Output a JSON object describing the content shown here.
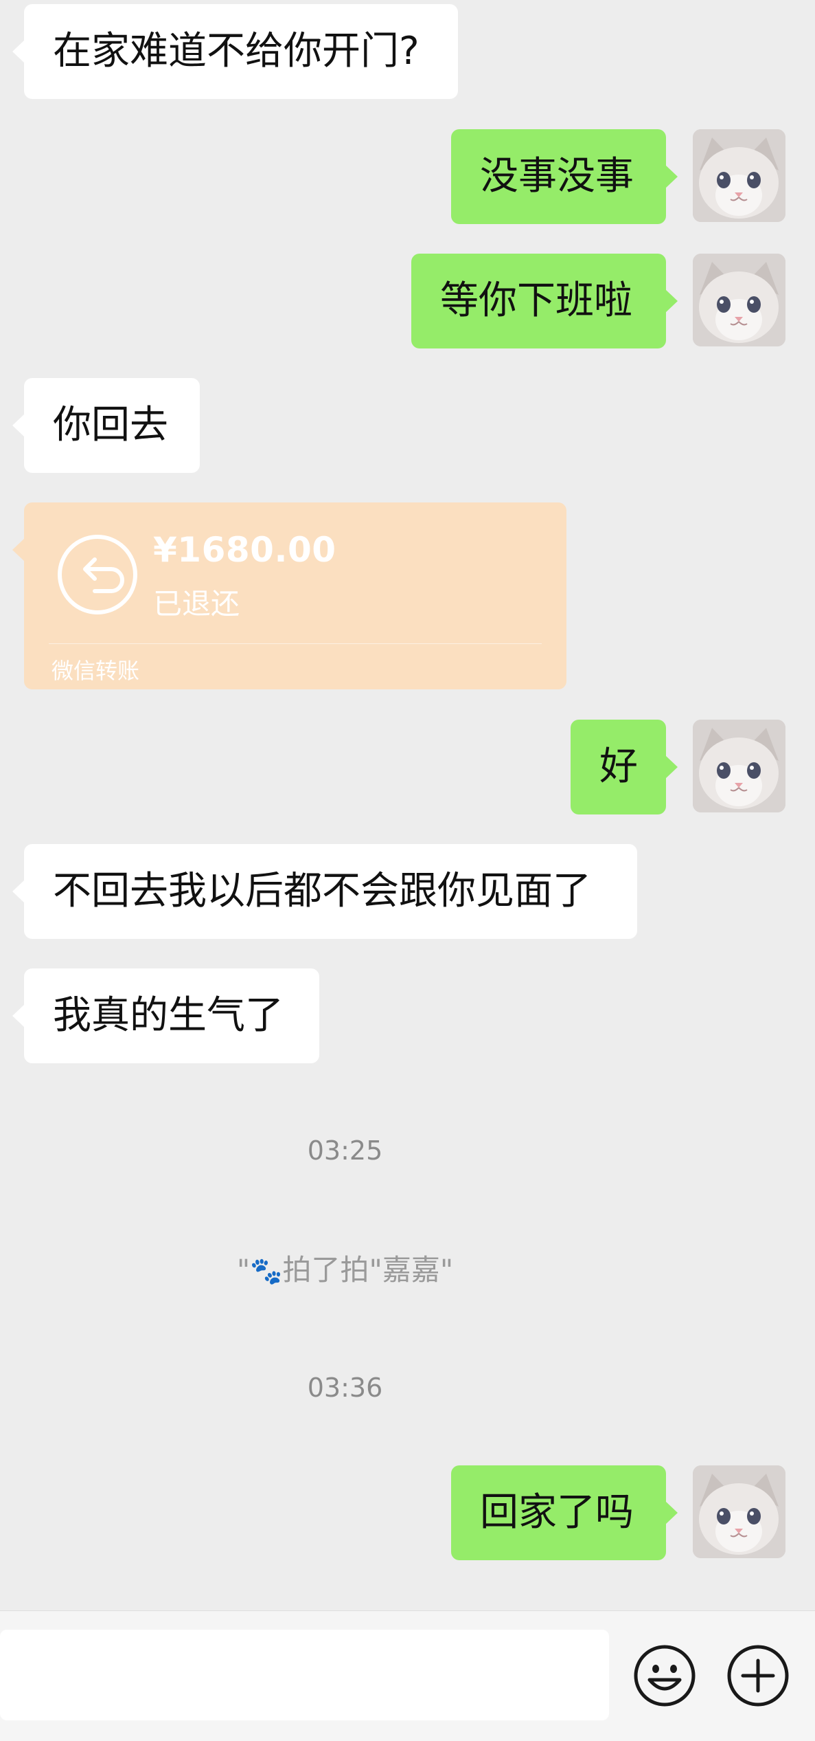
{
  "messages": [
    {
      "from": "other",
      "text": "在家难道不给你开门?"
    },
    {
      "from": "me",
      "text": "没事没事"
    },
    {
      "from": "me",
      "text": "等你下班啦"
    },
    {
      "from": "other",
      "text": "你回去"
    },
    {
      "from": "me",
      "text": "好"
    },
    {
      "from": "other",
      "text": "不回去我以后都不会跟你见面了"
    },
    {
      "from": "other",
      "text": "我真的生气了"
    },
    {
      "from": "me",
      "text": "回家了吗"
    }
  ],
  "transfer": {
    "amount": "¥1680.00",
    "status": "已退还",
    "label": "微信转账",
    "icon": "return-arrow-icon",
    "color": "#fbdfc0"
  },
  "timestamps": [
    "03:25",
    "03:36"
  ],
  "system_message": {
    "prefix": "\"",
    "icon": "paw-icon",
    "text": "拍了拍\"嘉嘉\""
  },
  "input_bar": {
    "emoji_icon": "emoji-icon",
    "plus_icon": "plus-icon"
  },
  "colors": {
    "background": "#ededed",
    "outgoing_bubble": "#95ec69",
    "incoming_bubble": "#ffffff"
  }
}
